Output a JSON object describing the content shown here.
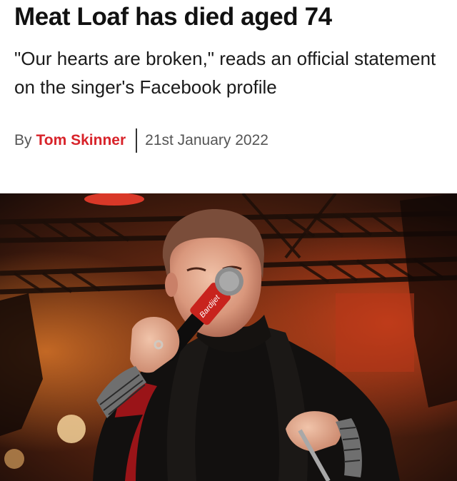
{
  "article": {
    "headline": "Meat Loaf has died aged 74",
    "standfirst": "\"Our hearts are broken,\" reads an official statement on the singer's Facebook profile",
    "byline_prefix": "By",
    "author": "Tom Skinner",
    "date": "21st January 2022"
  },
  "hero_image": {
    "mic_label": "Bardijet"
  },
  "colors": {
    "accent": "#d8232a",
    "text": "#111111",
    "meta": "#555555"
  }
}
